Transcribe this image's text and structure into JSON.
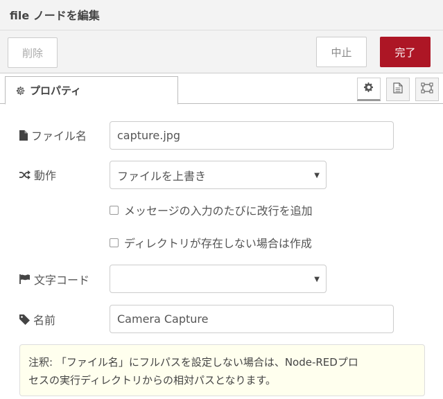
{
  "dialog": {
    "title": "file ノードを編集"
  },
  "buttons": {
    "delete_label": "削除",
    "cancel_label": "中止",
    "done_label": "完了"
  },
  "tabs": {
    "properties_label": "プロパティ"
  },
  "form": {
    "filename": {
      "label": "ファイル名",
      "value": "capture.jpg"
    },
    "action": {
      "label": "動作",
      "value": "ファイルを上書き"
    },
    "append_newline": {
      "label": "メッセージの入力のたびに改行を追加",
      "checked": false
    },
    "create_dir": {
      "label": "ディレクトリが存在しない場合は作成",
      "checked": false
    },
    "encoding": {
      "label": "文字コード",
      "value": ""
    },
    "name": {
      "label": "名前",
      "value": "Camera Capture"
    }
  },
  "tip": {
    "line1": "注釈: 「ファイル名」にフルパスを設定しない場合は、Node-REDプロ",
    "line2": "セスの実行ディレクトリからの相対パスとなります。"
  },
  "colors": {
    "primary": "#ad1625",
    "panel": "#f3f3f3",
    "tip_bg": "#ffffee"
  },
  "icons": [
    "gear-icon",
    "file-text-icon",
    "appearance-icon",
    "file-icon",
    "shuffle-icon",
    "flag-icon",
    "tag-icon"
  ]
}
